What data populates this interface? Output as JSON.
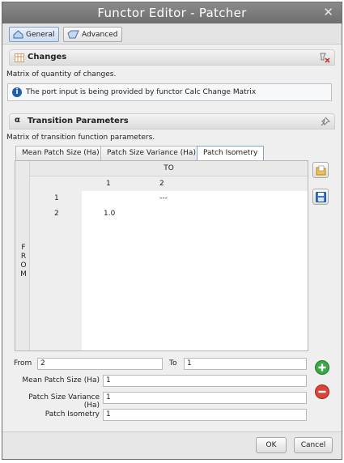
{
  "window": {
    "title": "Functor Editor - Patcher"
  },
  "top_tabs": [
    {
      "label": "General"
    },
    {
      "label": "Advanced"
    }
  ],
  "changes": {
    "title": "Changes",
    "description": "Matrix of quantity of changes.",
    "info": "The port input is being provided by functor Calc Change Matrix"
  },
  "transition": {
    "badge": "α",
    "title": "Transition Parameters",
    "description": "Matrix of transition function parameters.",
    "tabs": [
      {
        "label": "Mean Patch Size (Ha)"
      },
      {
        "label": "Patch Size Variance (Ha)"
      },
      {
        "label": "Patch Isometry"
      }
    ],
    "active_tab": "Patch Isometry",
    "matrix": {
      "to_label": "TO",
      "from_label": [
        "F",
        "R",
        "O",
        "M"
      ],
      "columns": [
        "1",
        "2"
      ],
      "rows": [
        {
          "label": "1",
          "cells": [
            "",
            "---"
          ]
        },
        {
          "label": "2",
          "cells": [
            "1.0",
            ""
          ]
        }
      ]
    },
    "form": {
      "from_label": "From",
      "from_value": "2",
      "to_label": "To",
      "to_value": "1",
      "mean_label": "Mean Patch Size (Ha)",
      "mean_value": "1",
      "variance_label": "Patch Size Variance (Ha)",
      "variance_value": "1",
      "isometry_label": "Patch Isometry",
      "isometry_value": "1"
    }
  },
  "footer": {
    "ok_label": "OK",
    "cancel_label": "Cancel"
  },
  "colors": {
    "title_bar": "#7b7b7b",
    "add": "#3aa845",
    "remove": "#d9453a",
    "info_icon": "#1f5fa6"
  }
}
